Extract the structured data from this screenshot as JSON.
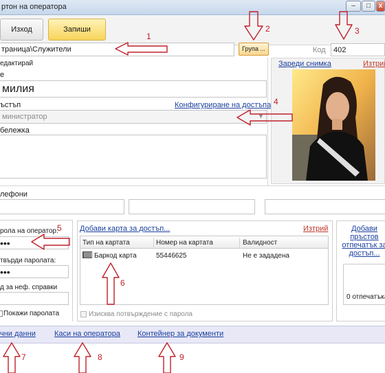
{
  "window": {
    "title": "ртон на оператора",
    "min": "–",
    "max": "□",
    "close": "x"
  },
  "toolbar": {
    "exit_label": "Изход",
    "save_label": "Запиши"
  },
  "path": {
    "value": "траница\\Служители",
    "group_button": "Група ...",
    "code_label": "Код",
    "code_value": "402"
  },
  "photo": {
    "load_link": "Зареди снимка",
    "delete_link": "Изтрий"
  },
  "form": {
    "edit_label": "едактирай",
    "name_label": "е",
    "name_value": "милия",
    "access_label": "ъстъп",
    "access_config_link": "Конфигуриране на достъпа",
    "access_value": "министратор",
    "note_label": "бележка",
    "phones_label": "лефони"
  },
  "password": {
    "label": "рола на оператор:",
    "value": "•••",
    "confirm_label": "твърди паролата:",
    "confirm_value": "•••",
    "ref_code_label": "д за неф. справки",
    "show_password_label": "Покажи паролата"
  },
  "access_cards": {
    "add_link": "Добави карта за достъп...",
    "delete_link": "Изтрий",
    "columns": [
      "Тип на картата",
      "Номер на картата",
      "Валидност"
    ],
    "rows": [
      {
        "type": "Баркод карта",
        "number": "55446625",
        "validity": "Не е зададена"
      }
    ],
    "require_password_label": "Изисква потвърждение с парола"
  },
  "fingerprints": {
    "add_link_line1": "Добави",
    "add_link_line2": "пръстов",
    "add_link_line3": "отпечатък за",
    "add_link_line4": "достъп...",
    "count_label": "0 отпечатъка"
  },
  "bottom_tabs": {
    "tab1": "чни данни",
    "tab2": "Каси на оператора",
    "tab3": "Контейнер за документи"
  },
  "annotations": {
    "n1": "1",
    "n2": "2",
    "n3": "3",
    "n4": "4",
    "n5": "5",
    "n6": "6",
    "n7": "7",
    "n8": "8",
    "n9": "9"
  },
  "colors": {
    "annotation": "#c0202a",
    "link": "#1a3f9e",
    "save_button": "#f7d55a"
  }
}
